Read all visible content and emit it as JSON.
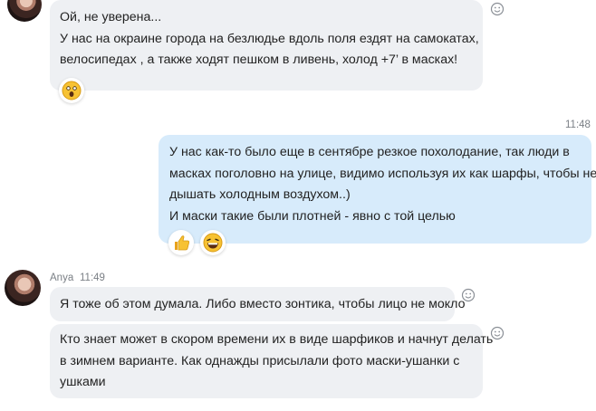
{
  "messages": [
    {
      "sender": "",
      "lines": [
        "Ой, не уверена...",
        "У нас на окраине города на безлюдье вдоль поля ездят на самокатах,",
        "велосипедах , а также ходят пешком в ливень, холод +7’ в масках!"
      ],
      "reaction": "scared-face"
    },
    {
      "time": "11:48",
      "lines": [
        "У нас как-то было еще в сентябре резкое похолодание, так люди в",
        "масках поголовно на улице, видимо используя их как шарфы, чтобы не",
        "дышать холодным воздухом..)",
        "И маски такие были плотней - явно с той целью"
      ],
      "reactions": [
        "thumbs-up",
        "laughing-face"
      ]
    },
    {
      "sender": "Anya",
      "time": "11:49",
      "lines": [
        "Я тоже об этом думала. Либо вместо зонтика, чтобы лицо не мокло"
      ]
    },
    {
      "lines": [
        "Кто знает может в скором времени их в виде шарфиков и начнут делать",
        "в зимнем варианте. Как однажды присылали фото маски-ушанки с",
        "ушками"
      ]
    }
  ],
  "colors": {
    "incoming_bubble": "#eef0f3",
    "outgoing_bubble": "#d7ebfb",
    "meta_text": "#7a7f85"
  },
  "icons": [
    "add-reaction-icon",
    "scared-face-icon",
    "thumbs-up-icon",
    "laughing-face-icon"
  ]
}
